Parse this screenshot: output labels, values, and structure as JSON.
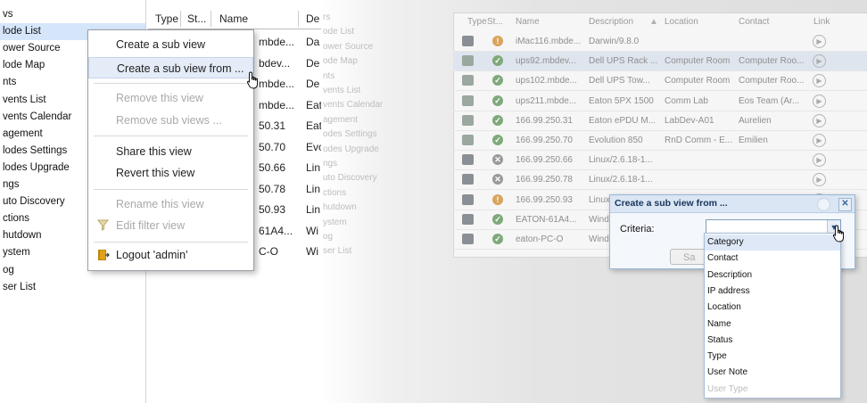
{
  "left": {
    "nav": [
      "vs",
      "lode List",
      "ower Source",
      "lode Map",
      "nts",
      "vents List",
      "vents Calendar",
      "agement",
      "lodes Settings",
      "lodes Upgrade",
      "ngs",
      "uto Discovery",
      "ctions",
      "hutdown",
      "ystem",
      "og",
      "ser List"
    ],
    "selected_nav": "lode List",
    "columns": [
      "Type",
      "St...",
      "Name",
      "De"
    ],
    "rows": [
      {
        "name": "mbde...",
        "desc": "Da"
      },
      {
        "name": "bdev...",
        "desc": "De"
      },
      {
        "name": "mbde...",
        "desc": "De"
      },
      {
        "name": "mbde...",
        "desc": "Eat"
      },
      {
        "name": "50.31",
        "desc": "Eat"
      },
      {
        "name": "50.70",
        "desc": "Evc"
      },
      {
        "name": "50.66",
        "desc": "Lin"
      },
      {
        "name": "50.78",
        "desc": "Lin"
      },
      {
        "name": "50.93",
        "desc": "Lin"
      },
      {
        "name": "61A4...",
        "desc": "Wi"
      },
      {
        "name": "C-O",
        "desc": "Wi"
      }
    ],
    "context_menu": {
      "create_sub_view": "Create a sub view",
      "create_sub_view_from": "Create a sub view from ...",
      "remove_view": "Remove this view",
      "remove_sub_views": "Remove sub views ...",
      "share_view": "Share this view",
      "revert_view": "Revert this view",
      "rename_view": "Rename this view",
      "edit_filter": "Edit filter view",
      "logout": "Logout 'admin'"
    }
  },
  "right": {
    "nav": [
      "rs",
      "ode List",
      "ower Source",
      "ode Map",
      "nts",
      "vents List",
      "vents Calendar",
      "agement",
      "odes Settings",
      "odes Upgrade",
      "ngs",
      "uto Discovery",
      "ctions",
      "hutdown",
      "ystem",
      "og",
      "ser List"
    ],
    "columns": {
      "type": "Type",
      "status": "St...",
      "name": "Name",
      "description": "Description",
      "location": "Location",
      "contact": "Contact",
      "link": "Link"
    },
    "rows": [
      {
        "type": "pc",
        "status": "warn",
        "name": "iMac116.mbde...",
        "description": "Darwin/9.8.0",
        "location": "",
        "contact": ""
      },
      {
        "type": "ups",
        "status": "ok",
        "name": "ups92.mbdev...",
        "description": "Dell UPS Rack ...",
        "location": "Computer Room",
        "contact": "Computer Roo..."
      },
      {
        "type": "ups",
        "status": "ok",
        "name": "ups102.mbde...",
        "description": "Dell UPS Tow...",
        "location": "Computer Room",
        "contact": "Computer Roo..."
      },
      {
        "type": "ups",
        "status": "ok",
        "name": "ups211.mbde...",
        "description": "Eaton 5PX 1500",
        "location": "Comm Lab",
        "contact": "Eos Team (Ar..."
      },
      {
        "type": "ups",
        "status": "ok",
        "name": "166.99.250.31",
        "description": "Eaton ePDU M...",
        "location": "LabDev-A01",
        "contact": "Aurelien"
      },
      {
        "type": "ups",
        "status": "ok",
        "name": "166.99.250.70",
        "description": "Evolution 850",
        "location": "RnD Comm - E...",
        "contact": "Emilien"
      },
      {
        "type": "pc",
        "status": "err",
        "name": "166.99.250.66",
        "description": "Linux/2.6.18-1...",
        "location": "",
        "contact": ""
      },
      {
        "type": "pc",
        "status": "err",
        "name": "166.99.250.78",
        "description": "Linux/2.6.18-1...",
        "location": "",
        "contact": ""
      },
      {
        "type": "pc",
        "status": "warn",
        "name": "166.99.250.93",
        "description": "Linux",
        "location": "",
        "contact": ""
      },
      {
        "type": "pc",
        "status": "ok",
        "name": "EATON-61A4...",
        "description": "Wind",
        "location": "",
        "contact": ""
      },
      {
        "type": "pc",
        "status": "ok",
        "name": "eaton-PC-O",
        "description": "Wind",
        "location": "",
        "contact": ""
      }
    ],
    "dialog": {
      "title": "Create a sub view from ...",
      "criteria_label": "Criteria:",
      "criteria_value": "",
      "save_label": "Sa",
      "options": [
        "Category",
        "Contact",
        "Description",
        "IP address",
        "Location",
        "Name",
        "Status",
        "Type",
        "User Note",
        "User Type"
      ]
    }
  }
}
